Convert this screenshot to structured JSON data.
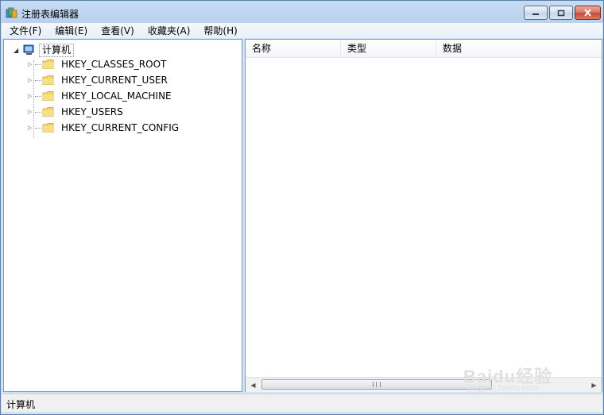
{
  "window": {
    "title": "注册表编辑器"
  },
  "menu": [
    "文件(F)",
    "编辑(E)",
    "查看(V)",
    "收藏夹(A)",
    "帮助(H)"
  ],
  "tree": {
    "root": "计算机",
    "items": [
      "HKEY_CLASSES_ROOT",
      "HKEY_CURRENT_USER",
      "HKEY_LOCAL_MACHINE",
      "HKEY_USERS",
      "HKEY_CURRENT_CONFIG"
    ]
  },
  "list": {
    "columns": [
      "名称",
      "类型",
      "数据"
    ]
  },
  "status": {
    "path": "计算机"
  },
  "watermark": {
    "brand": "Baidu经验",
    "url": "jingyan.baidu.com"
  },
  "colors": {
    "folder": "#f4d36b",
    "close_button": "#c24a33",
    "selection_border": "#7a8fae"
  }
}
